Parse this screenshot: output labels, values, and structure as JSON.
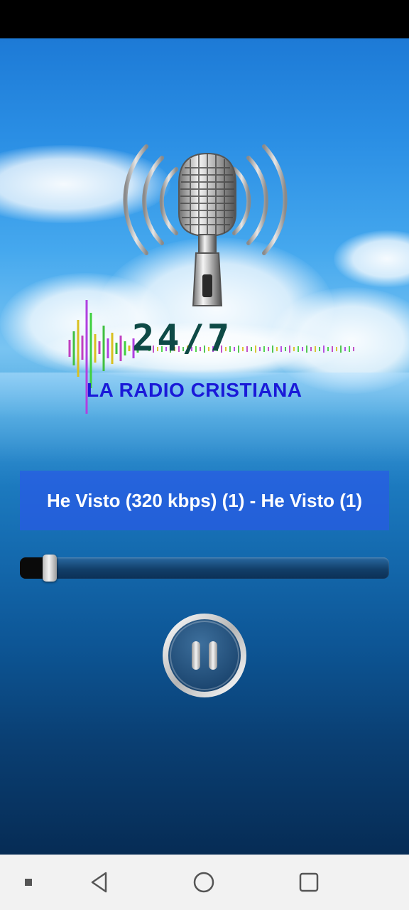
{
  "app": {
    "logo": {
      "title": "24/7",
      "subtitle": "LA RADIO CRISTIANA"
    },
    "player": {
      "now_playing": "He Visto (320 kbps) (1) - He Visto (1)",
      "progress": 0.08,
      "state": "playing",
      "control_icon": "pause-icon"
    }
  },
  "navigation": {
    "items": [
      "menu-square-icon",
      "back-triangle-icon",
      "home-circle-icon",
      "recents-square-icon"
    ]
  },
  "colors": {
    "title": "#0e4a46",
    "subtitle": "#1a1ad8",
    "now_playing_bg": "#2a5ae6",
    "nav_bar": "#f2f2f2"
  }
}
